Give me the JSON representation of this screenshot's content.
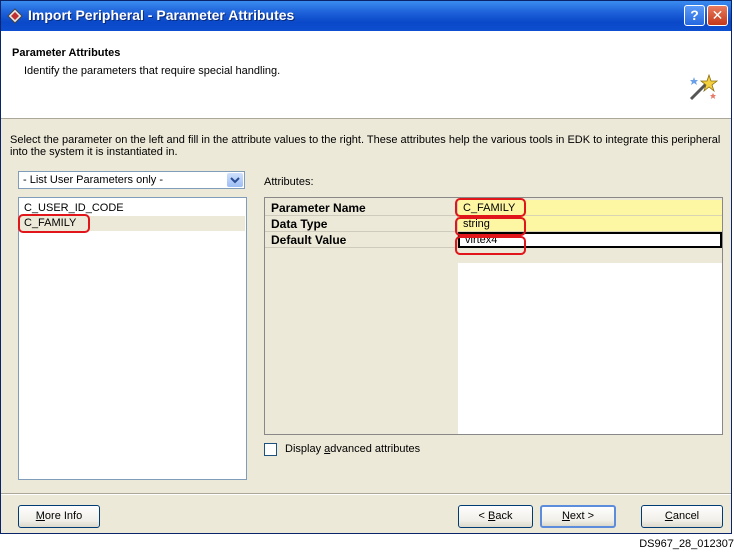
{
  "window": {
    "title": "Import Peripheral - Parameter Attributes",
    "help_label": "?",
    "close_label": "✕"
  },
  "header": {
    "title": "Parameter Attributes",
    "subtitle": "Identify the parameters that require special handling."
  },
  "instructions": "Select the parameter on the left and fill in the attribute values to the right. These attributes help the various tools in EDK to integrate this peripheral into the system it is instantiated in.",
  "filter_dropdown": {
    "value": "- List User Parameters only -",
    "options": [
      "- List User Parameters only -"
    ]
  },
  "parameters": [
    {
      "name": "C_USER_ID_CODE",
      "selected": false
    },
    {
      "name": "C_FAMILY",
      "selected": true
    }
  ],
  "attributes": {
    "label": "Attributes:",
    "rows": [
      {
        "key": "Parameter Name",
        "value": "C_FAMILY",
        "style": "readonly"
      },
      {
        "key": "Data Type",
        "value": "string",
        "style": "readonly"
      },
      {
        "key": "Default Value",
        "value": "virtex4",
        "style": "editable"
      }
    ]
  },
  "advanced_checkbox": {
    "label": "Display advanced attributes",
    "accelerator": "a",
    "checked": false
  },
  "buttons": {
    "more_info": {
      "label": "More Info",
      "accelerator": "M"
    },
    "back": {
      "label": "< Back",
      "accelerator": "B"
    },
    "next": {
      "label": "Next >",
      "accelerator": "N"
    },
    "cancel": {
      "label": "Cancel",
      "accelerator": "C"
    }
  },
  "figure_id": "DS967_28_012307",
  "colors": {
    "titlebar": "#0a48c8",
    "highlight": "#e0161b",
    "readonly_value_bg": "#fdf6a3",
    "dialog_bg": "#ece9d8"
  }
}
